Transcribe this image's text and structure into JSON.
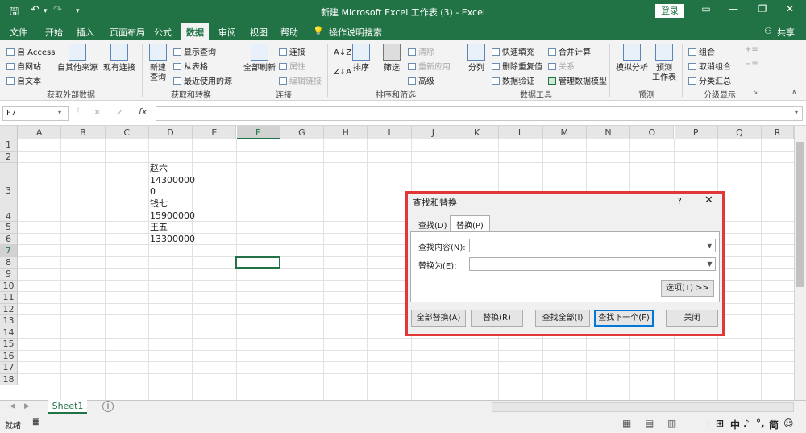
{
  "titlebar": {
    "title": "新建 Microsoft Excel 工作表 (3)  -  Excel",
    "login": "登录",
    "quick_save": "🖫",
    "undo": "↶",
    "redo": "↷",
    "qa_more": "▾"
  },
  "ribbon_tabs": [
    "文件",
    "开始",
    "插入",
    "页面布局",
    "公式",
    "数据",
    "审阅",
    "视图",
    "帮助"
  ],
  "tell_me": "操作说明搜索",
  "share": "共享",
  "ribbon": {
    "get_external": {
      "access": "自 Access",
      "web": "自网站",
      "text": "自文本",
      "other": "自其他来源",
      "existing": "现有连接",
      "label": "获取外部数据"
    },
    "get_transform": {
      "new_query": "新建",
      "new_query2": "查询",
      "show_queries": "显示查询",
      "from_table": "从表格",
      "recent": "最近使用的源",
      "label": "获取和转换"
    },
    "connections": {
      "refresh_all": "全部刷新",
      "connections": "连接",
      "properties": "属性",
      "edit_links": "编辑链接",
      "label": "连接"
    },
    "sort_filter": {
      "sort": "排序",
      "filter": "筛选",
      "clear": "清除",
      "reapply": "重新应用",
      "advanced": "高级",
      "label": "排序和筛选"
    },
    "data_tools": {
      "split": "分列",
      "flash_fill": "快速填充",
      "remove_dup": "删除重复值",
      "validation": "数据验证",
      "consolidate": "合并计算",
      "relations": "关系",
      "data_model": "管理数据模型",
      "label": "数据工具"
    },
    "forecast": {
      "whatif": "模拟分析",
      "sheet": "预测",
      "sheet2": "工作表",
      "label": "预测"
    },
    "outline": {
      "group": "组合",
      "ungroup": "取消组合",
      "subtotal": "分类汇总",
      "label": "分级显示"
    }
  },
  "formula_bar": {
    "name_box": "F7",
    "cancel": "✕",
    "enter": "✓",
    "fx": "fx",
    "value": ""
  },
  "columns": [
    "A",
    "B",
    "C",
    "D",
    "E",
    "F",
    "G",
    "H",
    "I",
    "J",
    "K",
    "L",
    "M",
    "N",
    "O",
    "P",
    "Q",
    "R"
  ],
  "rows": [
    "1",
    "2",
    "3",
    "4",
    "5",
    "6",
    "7",
    "8",
    "9",
    "10",
    "11",
    "12",
    "13",
    "14",
    "15",
    "16",
    "17",
    "18"
  ],
  "cells": {
    "d3_line1": "赵六",
    "d3_line2": "14300000",
    "d3_line3": "0",
    "d4_line1": "钱七",
    "d4_line2": "15900000",
    "d5_line1": "王五",
    "d5_line2": "13300000"
  },
  "sheet_tab": "Sheet1",
  "add_sheet": "+",
  "status": {
    "ready": "就绪",
    "ime": "中",
    "ime2": "简",
    "zoom_minus": "−",
    "zoom_plus": "+"
  },
  "dialog": {
    "title": "查找和替换",
    "help": "?",
    "close_x": "✕",
    "tab_find": "查找(D)",
    "tab_replace": "替换(P)",
    "find_label": "查找内容(N):",
    "replace_label": "替换为(E):",
    "find_value": "",
    "replace_value": "",
    "options": "选项(T) >>",
    "replace_all": "全部替换(A)",
    "replace": "替换(R)",
    "find_all": "查找全部(I)",
    "find_next": "查找下一个(F)",
    "close": "关闭"
  },
  "colors": {
    "excel_green": "#217346",
    "highlight_red": "#e03838"
  }
}
